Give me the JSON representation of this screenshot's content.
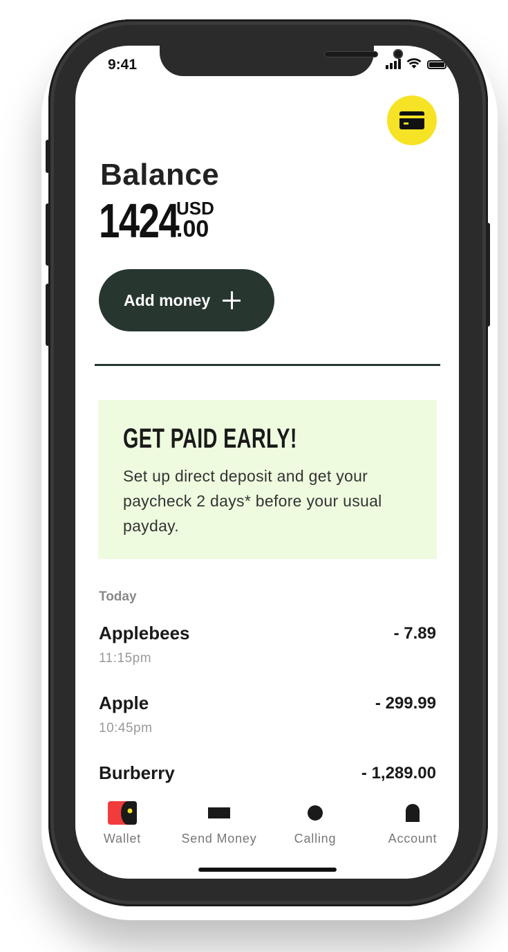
{
  "status_bar": {
    "time": "9:41"
  },
  "header": {
    "card_icon": "credit-card-icon",
    "card_button_color": "#f7e325"
  },
  "balance": {
    "label": "Balance",
    "integer": "1424",
    "currency": "USD",
    "decimal": ".00"
  },
  "actions": {
    "add_money_label": "Add money",
    "add_money_icon": "plus-icon",
    "add_money_color": "#27362f"
  },
  "promo": {
    "title": "GET PAID EARLY!",
    "body": "Set up direct deposit and get your paycheck 2 days* before your usual payday.",
    "background": "#eefbdf"
  },
  "transactions": {
    "section_label": "Today",
    "items": [
      {
        "name": "Applebees",
        "amount": "- 7.89",
        "time": "11:15pm"
      },
      {
        "name": "Apple",
        "amount": "- 299.99",
        "time": "10:45pm"
      },
      {
        "name": "Burberry",
        "amount": "- 1,289.00",
        "time": ""
      }
    ]
  },
  "tabbar": {
    "items": [
      {
        "label": "Wallet",
        "icon": "wallet-icon",
        "active": true
      },
      {
        "label": "Send Money",
        "icon": "send-money-icon",
        "active": false
      },
      {
        "label": "Calling",
        "icon": "calling-icon",
        "active": false
      },
      {
        "label": "Account",
        "icon": "account-icon",
        "active": false
      }
    ],
    "active_color": "#f23b3b"
  }
}
